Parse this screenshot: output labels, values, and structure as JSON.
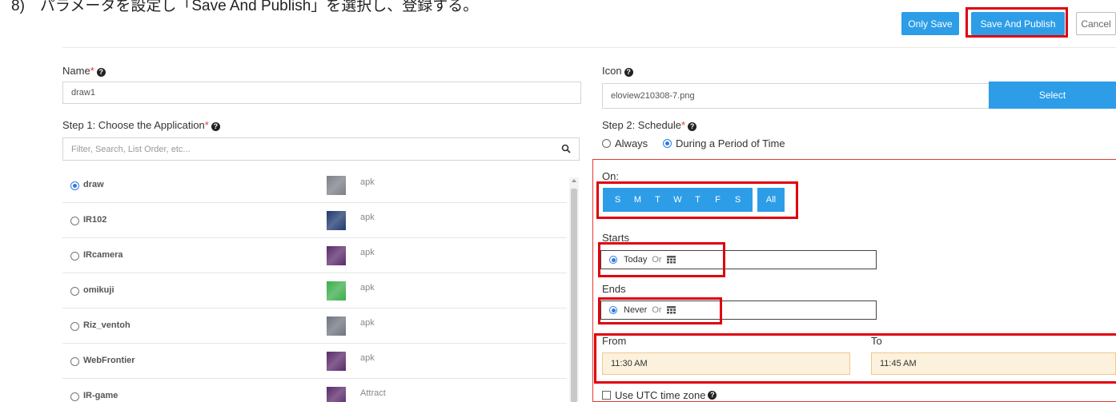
{
  "caption": "8)　パラメータを設定し「Save And Publish」を選択し、登録する。",
  "toolbar": {
    "only_save": "Only Save",
    "save_publish": "Save And Publish",
    "cancel": "Cancel"
  },
  "name_field": {
    "label": "Name",
    "required": "*",
    "value": "draw1"
  },
  "icon_field": {
    "label": "Icon",
    "value": "eloview210308-7.png",
    "select_label": "Select"
  },
  "step1": {
    "label": "Step 1: Choose the Application",
    "required": "*",
    "search_placeholder": "Filter, Search, List Order, etc..."
  },
  "apps": [
    {
      "name": "draw",
      "type": "apk",
      "selected": true,
      "color": "#7b7f87"
    },
    {
      "name": "IR102",
      "type": "apk",
      "selected": false,
      "color": "#1f3a6e"
    },
    {
      "name": "IRcamera",
      "type": "apk",
      "selected": false,
      "color": "#5a2a6a"
    },
    {
      "name": "omikuji",
      "type": "apk",
      "selected": false,
      "color": "#3cad4b"
    },
    {
      "name": "Riz_ventoh",
      "type": "apk",
      "selected": false,
      "color": "#6e757f"
    },
    {
      "name": "WebFrontier",
      "type": "apk",
      "selected": false,
      "color": "#5a2a6a"
    },
    {
      "name": "IR-game",
      "type": "Attract",
      "selected": false,
      "color": "#5a2a6a"
    }
  ],
  "step2": {
    "label": "Step 2: Schedule",
    "required": "*",
    "always": "Always",
    "period": "During a Period of Time",
    "on_label": "On:",
    "days": [
      "S",
      "M",
      "T",
      "W",
      "T",
      "F",
      "S"
    ],
    "all": "All",
    "starts_label": "Starts",
    "starts_value": "Today",
    "ends_label": "Ends",
    "ends_value": "Never",
    "or": "Or",
    "from_label": "From",
    "to_label": "To",
    "from_value": "11:30 AM",
    "to_value": "11:45 AM",
    "utc_label": "Use UTC time zone"
  },
  "colors": {
    "accent": "#2d9de8",
    "highlight": "#e0000e",
    "time_bg": "#fbf1dd"
  }
}
